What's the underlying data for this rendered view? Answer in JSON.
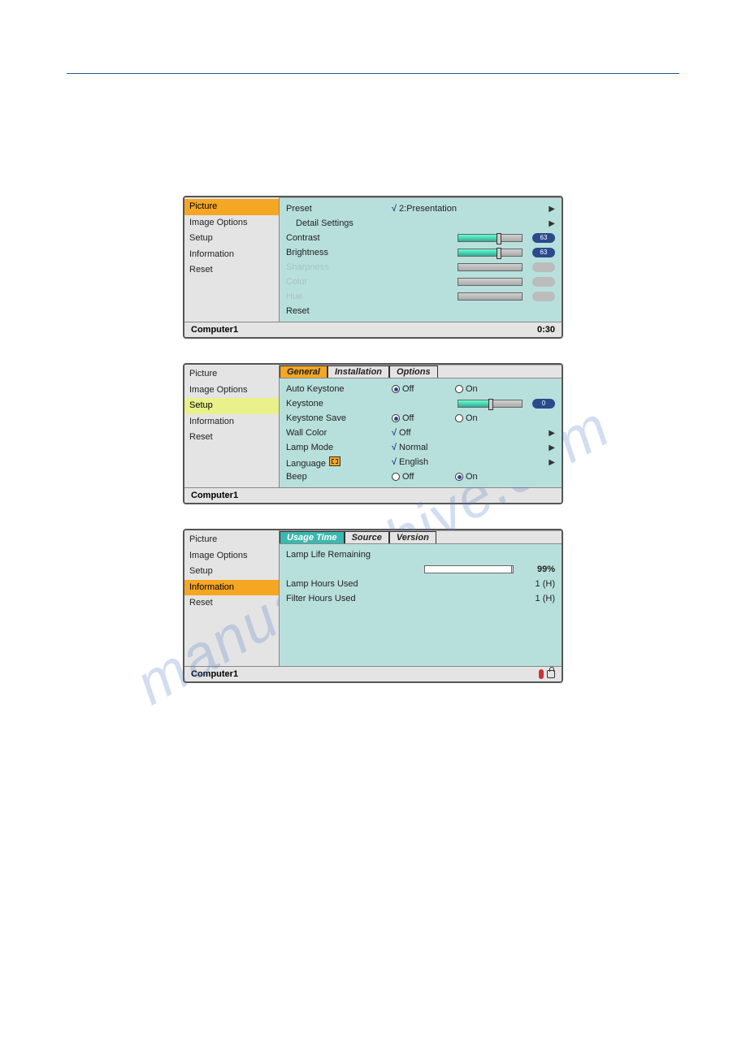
{
  "watermark": "manualarchive.com",
  "menu_items": [
    "Picture",
    "Image Options",
    "Setup",
    "Information",
    "Reset"
  ],
  "panel1": {
    "selected": "Picture",
    "preset_label": "Preset",
    "preset_value": "2:Presentation",
    "detail_label": "Detail Settings",
    "contrast_label": "Contrast",
    "contrast_value": "63",
    "brightness_label": "Brightness",
    "brightness_value": "63",
    "sharpness_label": "Sharpness",
    "color_label": "Color",
    "hue_label": "Hue",
    "reset_label": "Reset",
    "source": "Computer1",
    "time": "0:30"
  },
  "panel2": {
    "selected": "Setup",
    "tabs": [
      "General",
      "Installation",
      "Options"
    ],
    "auto_keystone_label": "Auto Keystone",
    "keystone_label": "Keystone",
    "keystone_value": "0",
    "keystone_save_label": "Keystone Save",
    "wall_color_label": "Wall Color",
    "wall_color_value": "Off",
    "lamp_mode_label": "Lamp Mode",
    "lamp_mode_value": "Normal",
    "language_label": "Language",
    "language_value": "English",
    "beep_label": "Beep",
    "off": "Off",
    "on": "On",
    "source": "Computer1"
  },
  "panel3": {
    "selected": "Information",
    "tabs": [
      "Usage Time",
      "Source",
      "Version"
    ],
    "lamp_life_label": "Lamp Life Remaining",
    "lamp_life_value": "99%",
    "lamp_hours_label": "Lamp Hours Used",
    "lamp_hours_value": "1 (H)",
    "filter_hours_label": "Filter Hours Used",
    "filter_hours_value": "1 (H)",
    "source": "Computer1"
  }
}
